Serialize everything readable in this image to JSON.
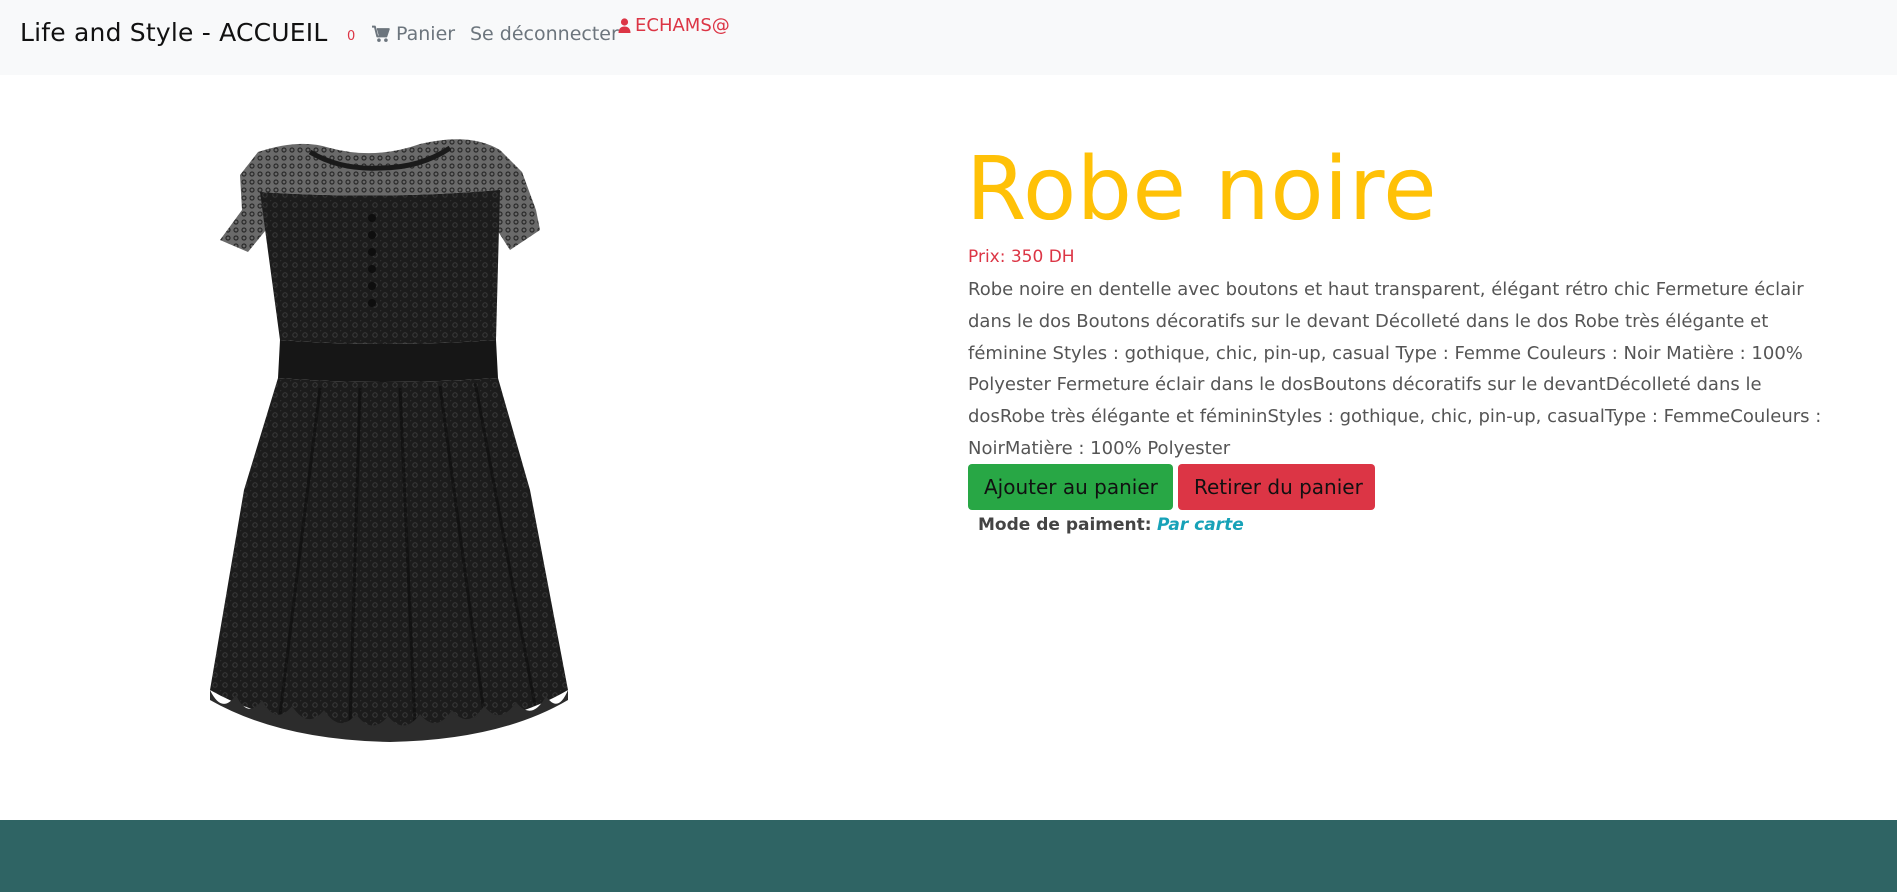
{
  "navbar": {
    "brand": "Life and Style - ACCUEIL",
    "cart_count": "0",
    "cart_label": "Panier",
    "cart_icon": "shopping-cart-icon",
    "logout_label": "Se déconnecter",
    "user_icon": "user-icon",
    "user_label": "ECHAMS@"
  },
  "product": {
    "image_alt": "Robe noire en dentelle",
    "title": "Robe noire",
    "price": "Prix: 350 DH",
    "description": "Robe noire en dentelle avec boutons et haut transparent, élégant rétro chic Fermeture éclair dans le dos Boutons décoratifs sur le devant Décolleté dans le dos Robe très élégante et féminine Styles : gothique, chic, pin-up, casual Type : Femme Couleurs : Noir Matière : 100% Polyester Fermeture éclair dans le dosBoutons décoratifs sur le devantDécolleté dans le dosRobe très élégante et fémininStyles : gothique, chic, pin-up, casualType : FemmeCouleurs : NoirMatière : 100% Polyester",
    "add_button": "Ajouter au panier",
    "remove_button": "Retirer du panier",
    "payment_label": "Mode de paiment:",
    "payment_value": "Par carte"
  },
  "colors": {
    "title": "#ffc107",
    "price": "#dc3545",
    "add_button": "#28a745",
    "remove_button": "#dc3545",
    "payment_value": "#17a2b8",
    "footer": "#2f6464",
    "navbar": "#f8f9fa"
  }
}
